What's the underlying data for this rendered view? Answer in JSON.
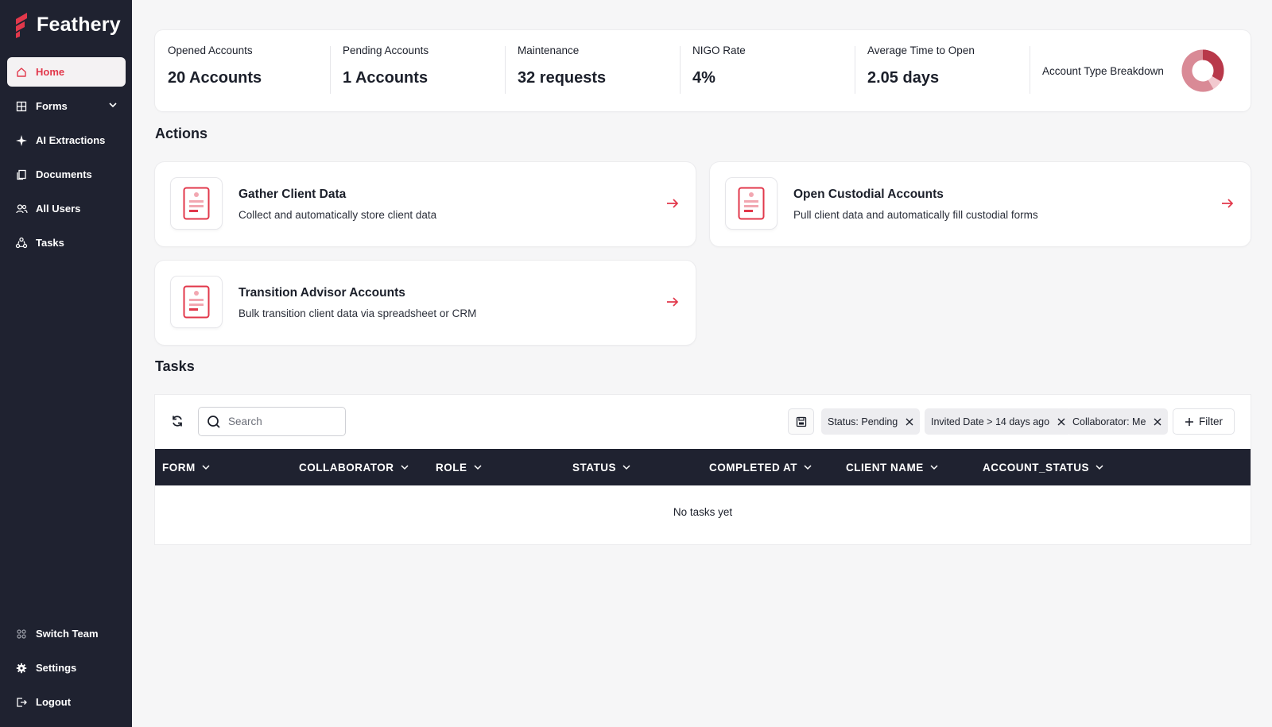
{
  "app": {
    "name": "Feathery",
    "accent": "#e2384b",
    "sidebar_bg": "#1f2230"
  },
  "sidebar": {
    "items": [
      {
        "label": "Home",
        "icon": "home-icon",
        "active": true
      },
      {
        "label": "Forms",
        "icon": "grid-icon",
        "has_dropdown": true
      },
      {
        "label": "AI Extractions",
        "icon": "sparkle-icon"
      },
      {
        "label": "Documents",
        "icon": "documents-icon"
      },
      {
        "label": "All Users",
        "icon": "users-icon"
      },
      {
        "label": "Tasks",
        "icon": "tasks-icon"
      }
    ],
    "bottom_items": [
      {
        "label": "Switch Team",
        "icon": "switch-team-icon"
      },
      {
        "label": "Settings",
        "icon": "gear-icon"
      },
      {
        "label": "Logout",
        "icon": "logout-icon"
      }
    ]
  },
  "stats": [
    {
      "label": "Opened Accounts",
      "value": "20 Accounts"
    },
    {
      "label": "Pending Accounts",
      "value": "1 Accounts"
    },
    {
      "label": "Maintenance",
      "value": "32 requests"
    },
    {
      "label": "NIGO Rate",
      "value": "4%"
    },
    {
      "label": "Average Time to Open",
      "value": "2.05 days"
    }
  ],
  "account_breakdown": {
    "label": "Account Type Breakdown",
    "chart_type": "donut",
    "colors": [
      "#b8384a",
      "#d98a96",
      "#f2c9cf"
    ]
  },
  "actions": {
    "title": "Actions",
    "cards": [
      {
        "title": "Gather Client Data",
        "description": "Collect and automatically store client data"
      },
      {
        "title": "Open Custodial Accounts",
        "description": "Pull client data and automatically fill custodial forms"
      },
      {
        "title": "Transition Advisor Accounts",
        "description": "Bulk transition client data via spreadsheet or CRM"
      }
    ]
  },
  "tasks": {
    "title": "Tasks",
    "search_placeholder": "Search",
    "filters": [
      {
        "label": "Status: Pending"
      },
      {
        "label": "Invited Date > 14 days ago"
      },
      {
        "label": "Collaborator: Me"
      }
    ],
    "filter_button": "Filter",
    "columns": [
      "FORM",
      "COLLABORATOR",
      "ROLE",
      "STATUS",
      "COMPLETED AT",
      "CLIENT NAME",
      "ACCOUNT_STATUS"
    ],
    "empty_text": "No tasks yet"
  }
}
